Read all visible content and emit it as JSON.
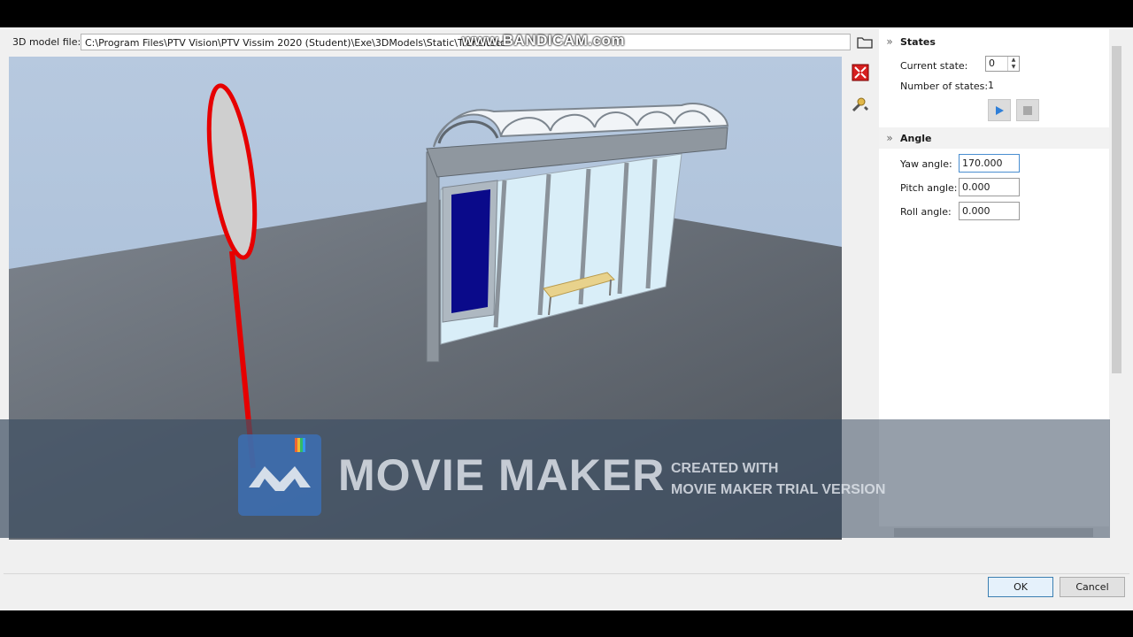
{
  "model_file": {
    "label": "3D model file:",
    "value": "C:\\Program Files\\PTV Vision\\PTV Vissim 2020 (Student)\\Exe\\3DModels\\Static\\TransitSto"
  },
  "toolbar_icons": [
    "browse-folder-icon",
    "fit-view-icon",
    "tools-wrench-icon"
  ],
  "states": {
    "header": "States",
    "current_state_label": "Current state:",
    "current_state_value": "0",
    "number_of_states_label": "Number of states:",
    "number_of_states_value": "1"
  },
  "angle": {
    "header": "Angle",
    "yaw_label": "Yaw angle:",
    "yaw_value": "170.000",
    "pitch_label": "Pitch angle:",
    "pitch_value": "0.000",
    "roll_label": "Roll angle:",
    "roll_value": "0.000"
  },
  "buttons": {
    "ok": "OK",
    "cancel": "Cancel"
  },
  "overlays": {
    "bandicam": "www.BANDICAM.com",
    "movie_maker_title": "MOVIE MAKER",
    "movie_maker_line1": "CREATED WITH",
    "movie_maker_line2": "MOVIE MAKER TRIAL VERSION"
  },
  "colors": {
    "accent": "#3c7fb1",
    "play": "#2f7fd8",
    "stop_sign": "#e60000",
    "poster": "#0a0a8a"
  }
}
